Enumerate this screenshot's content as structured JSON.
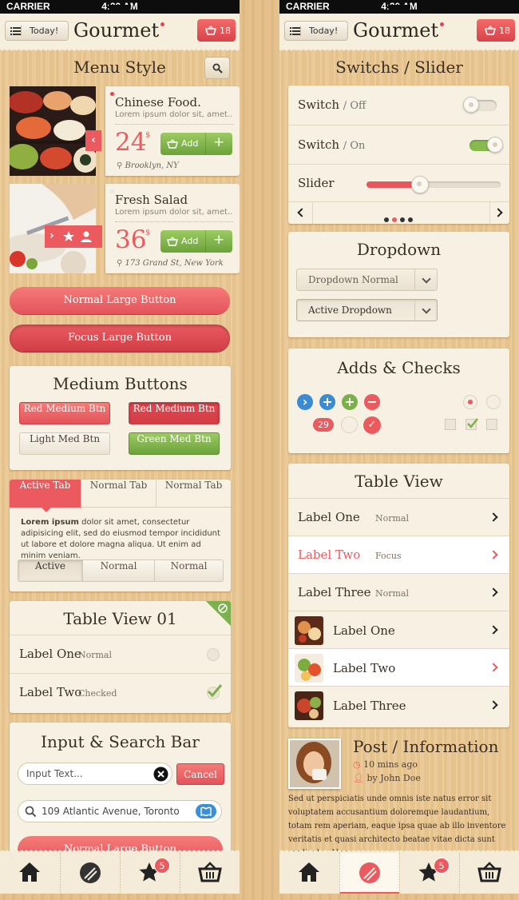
{
  "status": {
    "carrier": "CARRIER",
    "time": "4:20 AM"
  },
  "nav": {
    "menu_label": "Today!",
    "logo": "Gourmet",
    "cart_count": "18"
  },
  "left": {
    "menu_style_title": "Menu Style",
    "foods": [
      {
        "name": "Chinese Food.",
        "desc": "Lorem ipsum dolor sit, amet...",
        "price": "24",
        "currency": "$",
        "add_label": "Add",
        "location": "Brooklyn, NY"
      },
      {
        "name": "Fresh Salad",
        "desc": "Lorem ipsum dolor sit, amet...",
        "price": "36",
        "currency": "$",
        "add_label": "Add",
        "location": "173 Grand St, New York"
      }
    ],
    "normal_large_button": "Normal Large Button",
    "focus_large_button": "Focus Large Button",
    "medium_buttons": {
      "title": "Medium Buttons",
      "red1": "Red Medium Btn",
      "red2": "Red Medium Btn",
      "light": "Light Med Btn",
      "green": "Green Med Btn"
    },
    "tabs": {
      "labels": [
        "Active Tab",
        "Normal Tab",
        "Normal Tab"
      ],
      "text_bold": "Lorem ipsum",
      "text": " dolor sit amet, consectetur adipisicing elit, sed do eiusmod tempor incididunt ut labore et dolore magna aliqua. Ut enim ad minim veniam.",
      "segments": [
        "Active",
        "Normal",
        "Normal"
      ]
    },
    "table_view_01": {
      "title": "Table View 01",
      "rows": [
        {
          "label": "Label One",
          "sub": "Normal"
        },
        {
          "label": "Label Two",
          "sub": "Checked"
        }
      ]
    },
    "input_search": {
      "title": "Input & Search Bar",
      "input_placeholder": "Input Text...",
      "cancel": "Cancel",
      "search_value": "109 Atlantic Avenue, Toronto",
      "partial_button": "Normal Large Button"
    }
  },
  "right": {
    "switches_title": "Switchs / Slider",
    "switch_off": {
      "label": "Switch",
      "state": "Off"
    },
    "switch_on": {
      "label": "Switch",
      "state": "On"
    },
    "slider": {
      "label": "Slider",
      "value": 0.4
    },
    "pager": {
      "pages": 4,
      "current": 2
    },
    "dropdown": {
      "title": "Dropdown",
      "normal": "Dropdown Normal",
      "active": "Active Dropdown"
    },
    "adds_checks": {
      "title": "Adds & Checks",
      "count": "29"
    },
    "table_view": {
      "title": "Table View",
      "rows": [
        {
          "label": "Label One",
          "sub": "Normal"
        },
        {
          "label": "Label Two",
          "sub": "Focus"
        },
        {
          "label": "Label Three",
          "sub": "Normal"
        }
      ],
      "image_rows": [
        {
          "label": "Label One"
        },
        {
          "label": "Label Two"
        },
        {
          "label": "Label Three"
        }
      ]
    },
    "post": {
      "title": "Post / Information",
      "time": "10 mins ago",
      "author": "by John Doe",
      "body": "Sed ut perspiciatis unde omnis iste natus error sit voluptatem accusantium doloremque laudantium, totam rem aperiam, eaque ipsa quae ab illo inventore veritatis et quasi architecto beatae vitae dicta sunt explicabo. Nemo"
    }
  },
  "tabbar": {
    "badge": "5"
  },
  "colors": {
    "accent": "#ea5a5e",
    "green": "#7cb04a",
    "wood": "#e9c690",
    "card": "#f7f1e3"
  }
}
